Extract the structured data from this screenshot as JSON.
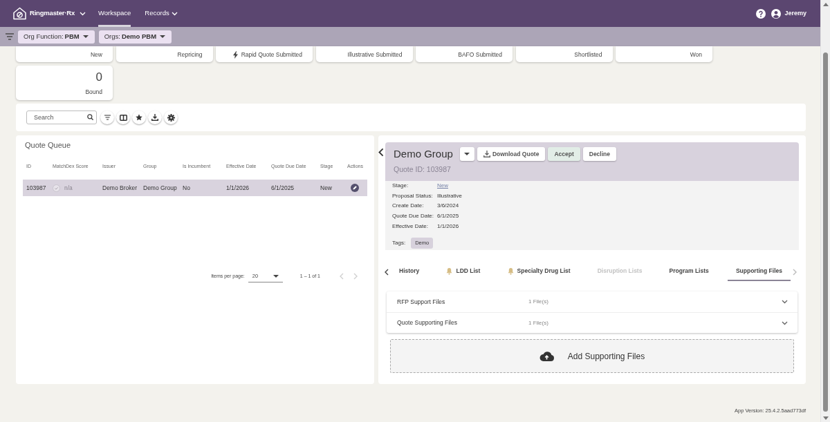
{
  "navbar": {
    "brand": "Ringmaster·Rx",
    "items": [
      {
        "label": "Workspace",
        "selected": true,
        "dropdown": false
      },
      {
        "label": "Records",
        "selected": false,
        "dropdown": true
      }
    ],
    "user": "Jeremy"
  },
  "filters": [
    {
      "label": "Org Function:",
      "value": "PBM"
    },
    {
      "label": "Orgs:",
      "value": "Demo PBM"
    }
  ],
  "stages": [
    {
      "label": "New",
      "kind": "plain"
    },
    {
      "label": "Repricing",
      "kind": "plain"
    },
    {
      "label": "Rapid Quote Submitted",
      "kind": "rapid"
    },
    {
      "label": "Illustrative Submitted",
      "kind": "plain"
    },
    {
      "label": "BAFO Submitted",
      "kind": "plain"
    },
    {
      "label": "Shortlisted",
      "kind": "plain"
    },
    {
      "label": "Won",
      "kind": "plain"
    },
    {
      "label": "Bound",
      "kind": "plain",
      "count": "0"
    }
  ],
  "toolbar": {
    "search": {
      "placeholder": "Search"
    }
  },
  "quote_queue": {
    "title": "Quote Queue",
    "columns": [
      "ID",
      "MatchDex Score",
      "Issuer",
      "Group",
      "Is Incumbent",
      "Effective Date",
      "Quote Due Date",
      "Stage",
      "Actions"
    ],
    "rows": [
      {
        "selected": true,
        "cells": [
          "103987",
          "n/a",
          "Demo Broker",
          "Demo Group",
          "No",
          "1/1/2026",
          "6/1/2025",
          "New"
        ]
      }
    ],
    "pagination": {
      "label": "Items per page:",
      "page_size": "20",
      "range": "1 – 1 of 1",
      "prev_disabled": true,
      "next_disabled": true
    }
  },
  "quote_detail": {
    "title": "Demo Group",
    "quote_id": "Quote ID: 103987",
    "buttons": [
      {
        "label": "Download Quote",
        "kind": "download"
      },
      {
        "label": "Accept",
        "kind": "accept"
      },
      {
        "label": "Decline",
        "kind": "decline"
      }
    ],
    "fields": [
      {
        "label": "Stage:",
        "value": "New",
        "kind": "link"
      },
      {
        "label": "Proposal Status:",
        "value": "Illustrative",
        "kind": "text"
      },
      {
        "label": "Create Date:",
        "value": "3/6/2024",
        "kind": "text"
      },
      {
        "label": "Quote Due Date:",
        "value": "6/1/2025",
        "kind": "text"
      },
      {
        "label": "Effective Date:",
        "value": "1/1/2026",
        "kind": "text"
      }
    ],
    "tags_label": "Tags:",
    "tags": [
      "Demo"
    ],
    "tab_scroll": {
      "prev_disabled": false,
      "next_disabled": true
    },
    "tabs": [
      {
        "label": "History",
        "selected": false,
        "disabled": false,
        "alert": false
      },
      {
        "label": "LDD List",
        "selected": false,
        "disabled": false,
        "alert": true
      },
      {
        "label": "Specialty Drug List",
        "selected": false,
        "disabled": false,
        "alert": true
      },
      {
        "label": "Disruption Lists",
        "selected": false,
        "disabled": true,
        "alert": false
      },
      {
        "label": "Program Lists",
        "selected": false,
        "disabled": false,
        "alert": false
      },
      {
        "label": "Supporting Files",
        "selected": true,
        "disabled": false,
        "alert": false
      }
    ],
    "file_groups": [
      {
        "name": "RFP Support Files",
        "count": "1 File(s)",
        "expanded": false
      },
      {
        "name": "Quote Supporting Files",
        "count": "1 File(s)",
        "expanded": false
      }
    ],
    "dropzone": {
      "label": "Add Supporting Files"
    }
  },
  "footer": {
    "app_version": "App Version: 25.4.2.5aad773df"
  }
}
